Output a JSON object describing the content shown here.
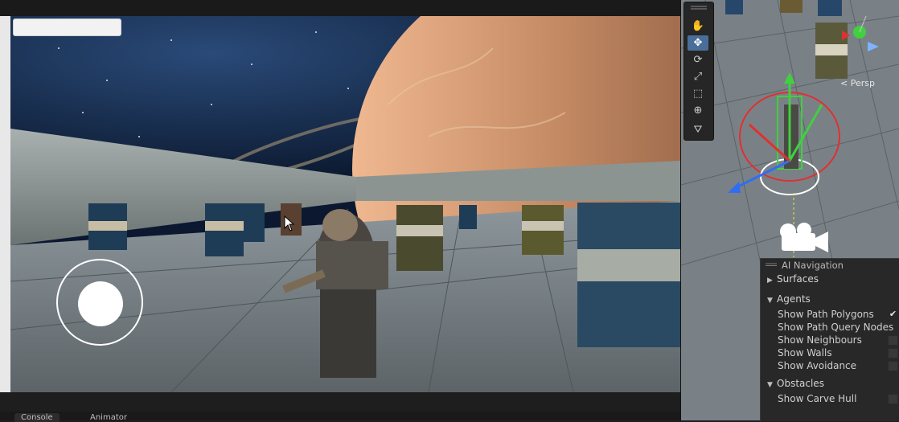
{
  "game_view": {
    "input_value": "",
    "bottom_tabs": [
      {
        "label": "Console"
      },
      {
        "label": "Animator"
      }
    ]
  },
  "scene_view": {
    "projection_label": "< Persp",
    "tools": [
      {
        "name": "hand-tool",
        "glyph": "✋",
        "active": false
      },
      {
        "name": "move-tool",
        "glyph": "✥",
        "active": true
      },
      {
        "name": "rotate-tool",
        "glyph": "⟳",
        "active": false
      },
      {
        "name": "scale-tool",
        "glyph": "⤢",
        "active": false
      },
      {
        "name": "rect-tool",
        "glyph": "⬚",
        "active": false
      },
      {
        "name": "transform-tool",
        "glyph": "⊕",
        "active": false
      },
      {
        "name": "custom-tool",
        "glyph": "⛛",
        "active": false
      }
    ]
  },
  "ai_navigation": {
    "title": "AI Navigation",
    "sections": [
      {
        "label": "Surfaces",
        "expanded": false,
        "options": []
      },
      {
        "label": "Agents",
        "expanded": true,
        "options": [
          {
            "label": "Show Path Polygons",
            "checked": true
          },
          {
            "label": "Show Path Query Nodes",
            "checked": false
          },
          {
            "label": "Show Neighbours",
            "checked": false
          },
          {
            "label": "Show Walls",
            "checked": false
          },
          {
            "label": "Show Avoidance",
            "checked": false
          }
        ]
      },
      {
        "label": "Obstacles",
        "expanded": true,
        "options": [
          {
            "label": "Show Carve Hull",
            "checked": false
          }
        ]
      }
    ]
  },
  "colors": {
    "active_tool": "#4a6e9a",
    "gizmo_x": "#e03030",
    "gizmo_y": "#40d040",
    "gizmo_z": "#2f6ef0"
  },
  "icons": {
    "arrow_collapsed": "▶",
    "arrow_expanded": "▼",
    "check": "✔"
  }
}
